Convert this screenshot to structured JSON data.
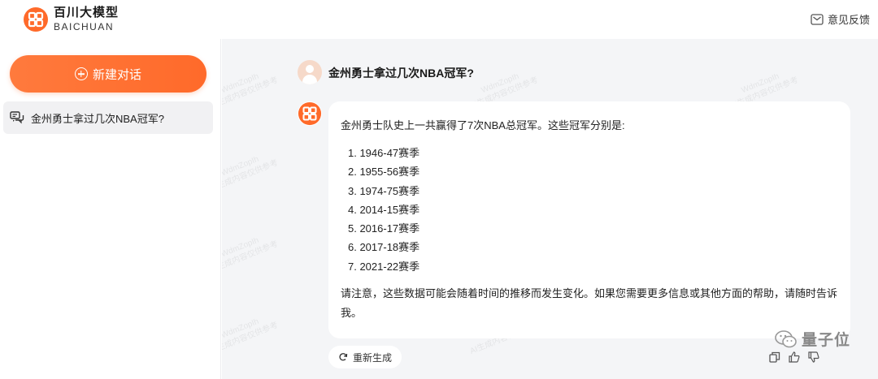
{
  "header": {
    "brand_cn": "百川大模型",
    "brand_en": "BAICHUAN",
    "feedback_label": "意见反馈"
  },
  "sidebar": {
    "new_chat_label": "新建对话",
    "history": [
      {
        "title": "金州勇士拿过几次NBA冠军?"
      }
    ]
  },
  "chat": {
    "question": "金州勇士拿过几次NBA冠军?",
    "answer_intro": "金州勇士队史上一共赢得了7次NBA总冠军。这些冠军分别是:",
    "answer_list": [
      "1. 1946-47赛季",
      "2. 1955-56赛季",
      "3. 1974-75赛季",
      "4. 2014-15赛季",
      "5. 2016-17赛季",
      "6. 2017-18赛季",
      "7. 2021-22赛季"
    ],
    "answer_note": "请注意，这些数据可能会随着时间的推移而发生变化。如果您需要更多信息或其他方面的帮助，请随时告诉我。",
    "regenerate_label": "重新生成"
  },
  "watermark": {
    "line1": "WdmZopIh",
    "line2": "AI生成内容仅供参考"
  },
  "corner_logo": {
    "label": "量子位"
  },
  "colors": {
    "accent": "#ff6a2a",
    "main_bg": "#f4f5f7"
  }
}
